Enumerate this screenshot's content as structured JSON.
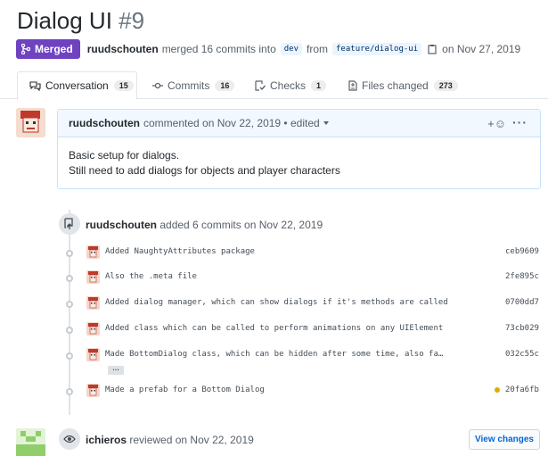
{
  "pr": {
    "title": "Dialog UI",
    "number": "#9",
    "state": "Merged",
    "author": "ruudschouten",
    "action": "merged 16 commits into",
    "base_branch": "dev",
    "from_text": "from",
    "head_branch": "feature/dialog-ui",
    "date_text": "on Nov 27, 2019"
  },
  "tabs": [
    {
      "label": "Conversation",
      "count": "15",
      "icon": "comment-discussion-icon"
    },
    {
      "label": "Commits",
      "count": "16",
      "icon": "git-commit-icon"
    },
    {
      "label": "Checks",
      "count": "1",
      "icon": "checklist-icon"
    },
    {
      "label": "Files changed",
      "count": "273",
      "icon": "file-diff-icon"
    }
  ],
  "comment": {
    "author": "ruudschouten",
    "meta": "commented on Nov 22, 2019 • edited",
    "reaction": "+☺",
    "more": "···",
    "lines": [
      "Basic setup for dialogs.",
      "Still need to add dialogs for objects and player characters"
    ]
  },
  "commits_event": {
    "author": "ruudschouten",
    "text": "added 6 commits on Nov 22, 2019",
    "commits": [
      {
        "message": "Added NaughtyAttributes package",
        "sha": "ceb9609"
      },
      {
        "message": "Also the .meta file",
        "sha": "2fe895c"
      },
      {
        "message": "Added dialog manager, which can show dialogs if it's methods are called",
        "sha": "0700dd7"
      },
      {
        "message": "Added class which can be called to perform animations on any UIElement",
        "sha": "73cb029"
      },
      {
        "message": "Made BottomDialog class, which can be hidden after some time, also fa…",
        "sha": "032c55c"
      },
      {
        "message": "Made a prefab for a Bottom Dialog",
        "sha": "20fa6fb"
      }
    ],
    "expand_label": "…"
  },
  "review": {
    "author": "ichieros",
    "text": "reviewed on Nov 22, 2019",
    "button": "View changes"
  },
  "colors": {
    "merged": "#6f42c1",
    "link": "#0366d6",
    "pending": "#dbab09"
  }
}
